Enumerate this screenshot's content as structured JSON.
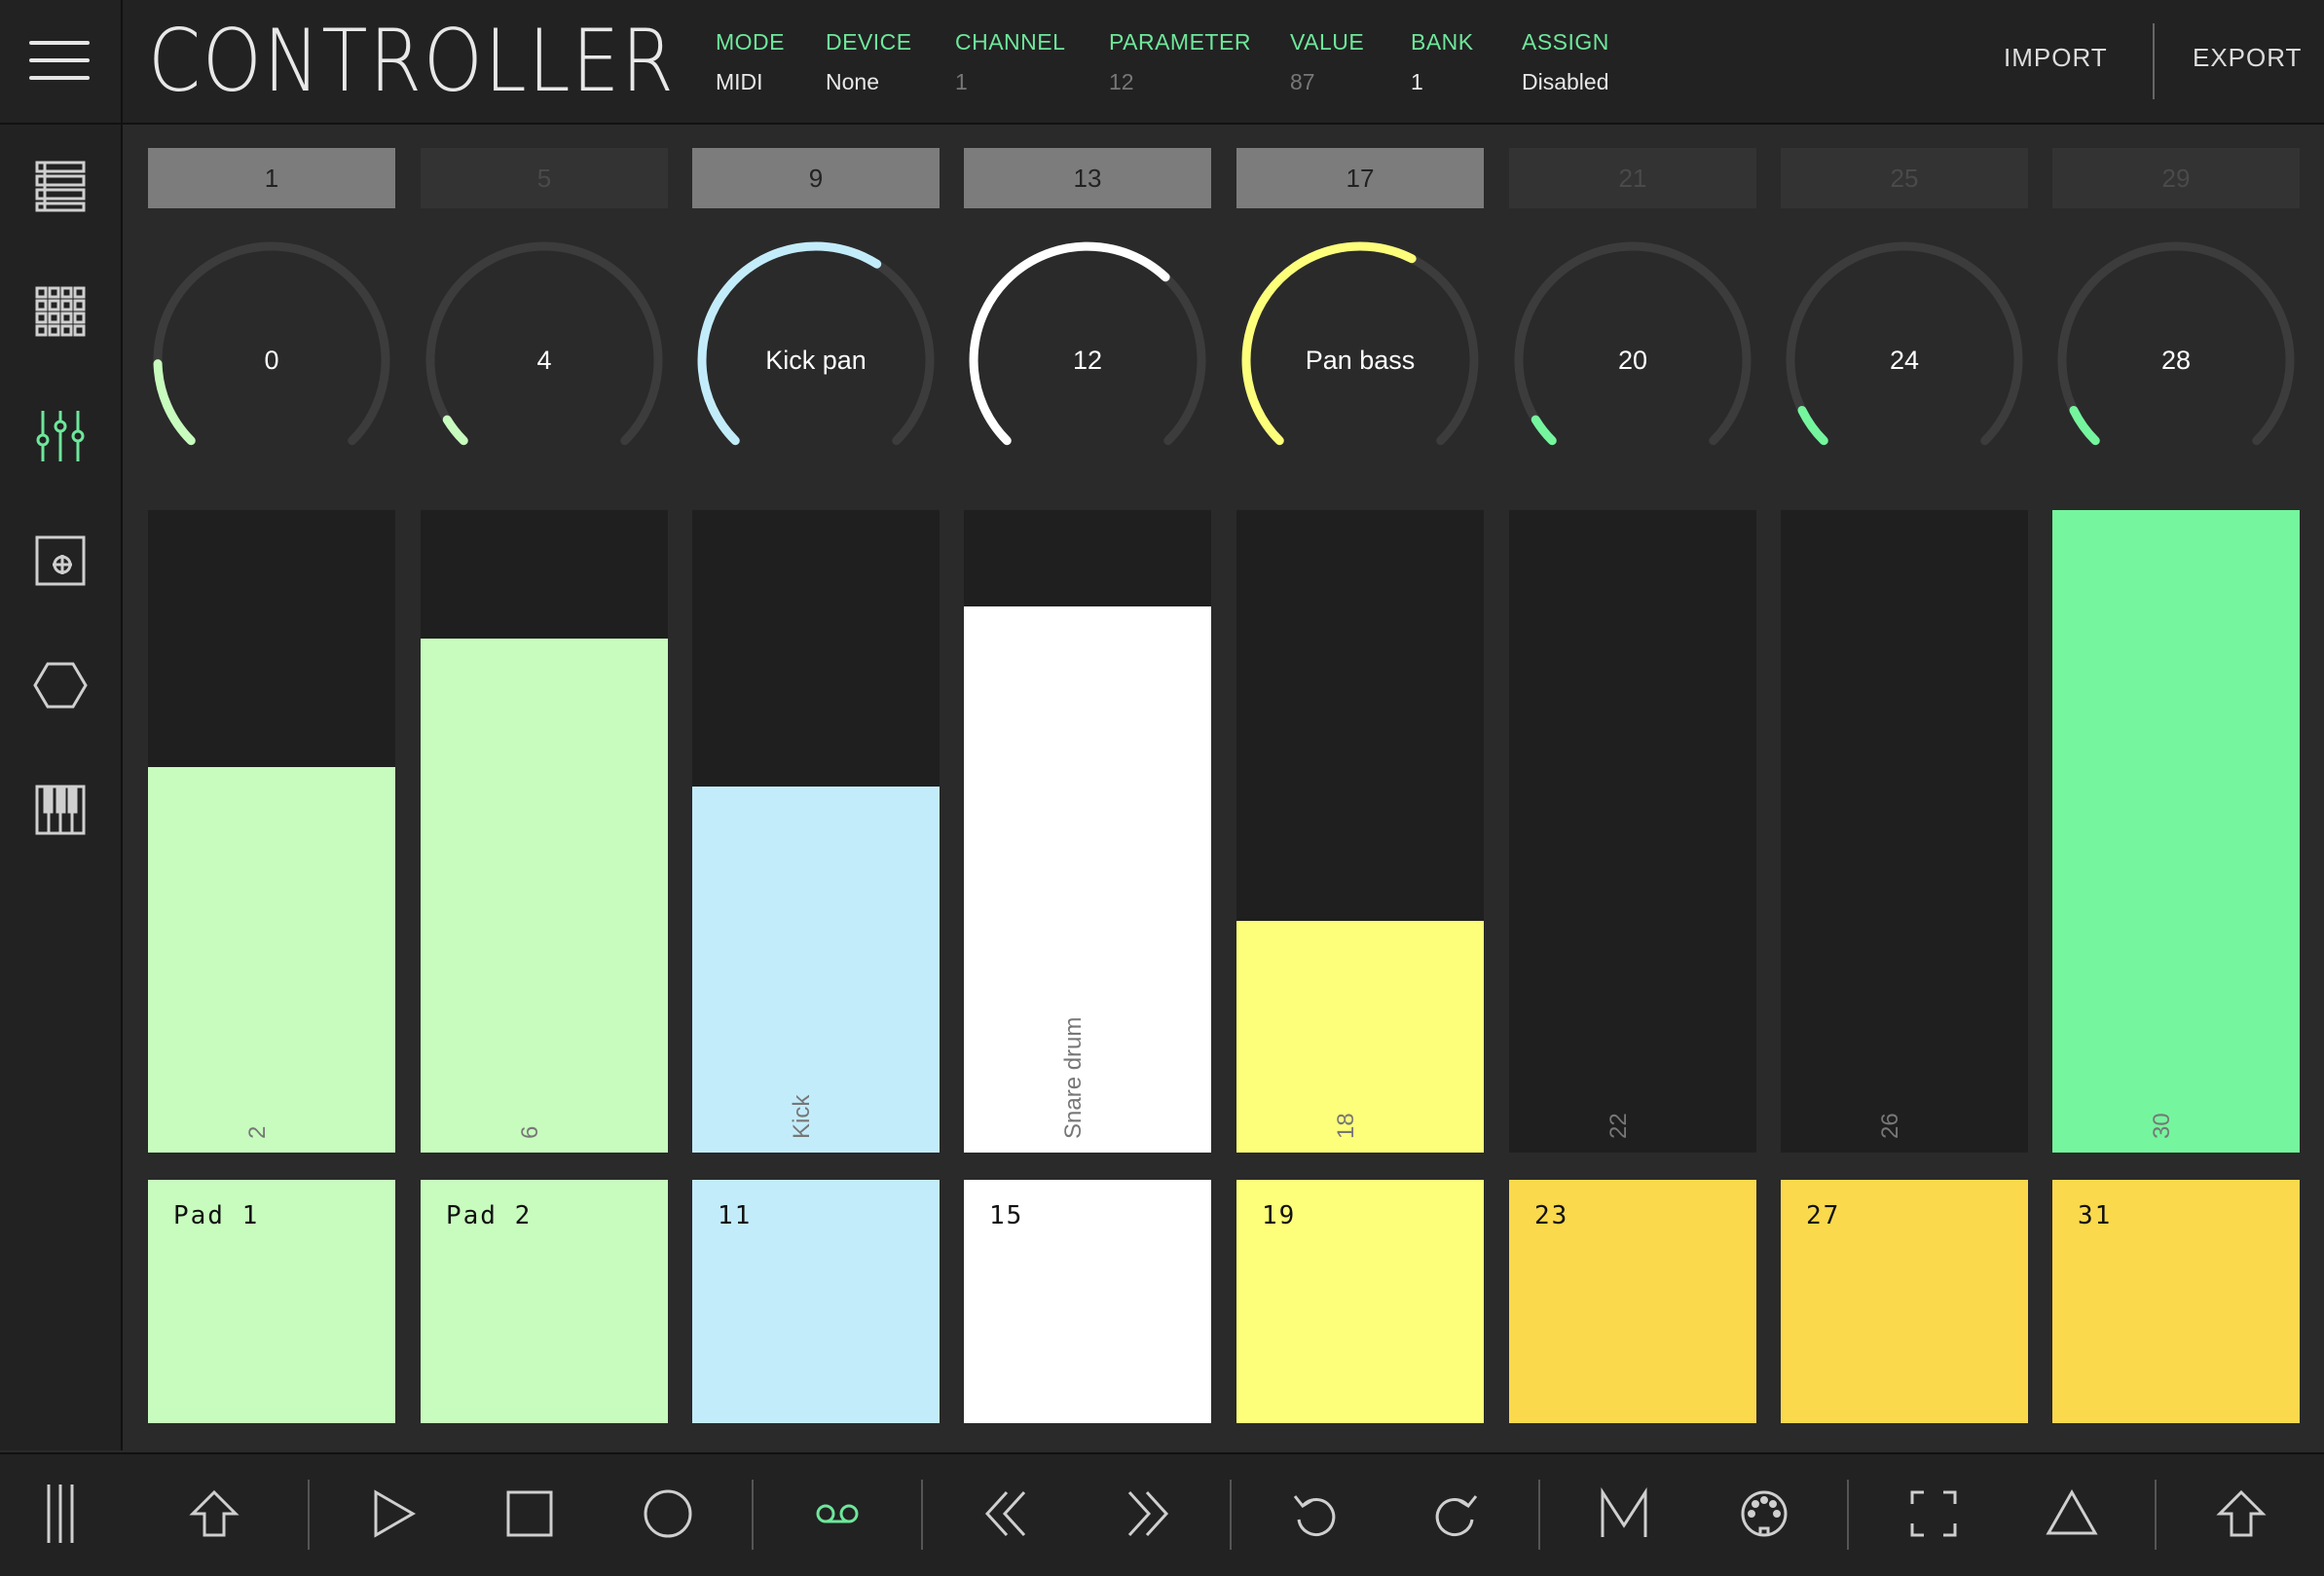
{
  "app": {
    "title": "CONTROLLER"
  },
  "header": {
    "mode": {
      "label": "MODE",
      "value": "MIDI"
    },
    "device": {
      "label": "DEVICE",
      "value": "None"
    },
    "channel": {
      "label": "CHANNEL",
      "value": "1"
    },
    "parameter": {
      "label": "PARAMETER",
      "value": "12"
    },
    "value": {
      "label": "VALUE",
      "value": "87"
    },
    "bank": {
      "label": "BANK",
      "value": "1"
    },
    "assign": {
      "label": "ASSIGN",
      "value": "Disabled"
    },
    "import_label": "IMPORT",
    "export_label": "EXPORT"
  },
  "sidebar": {
    "items": [
      {
        "icon": "list-icon"
      },
      {
        "icon": "grid-icon"
      },
      {
        "icon": "mixer-sliders-icon",
        "active": true
      },
      {
        "icon": "xy-pad-icon"
      },
      {
        "icon": "hexagon-icon"
      },
      {
        "icon": "piano-keys-icon"
      }
    ]
  },
  "colors": {
    "accent": "#6ee79b",
    "light_green": "#c8fcbe",
    "light_blue": "#c3ecfb",
    "white": "#ffffff",
    "yellow": "#fdfe7a",
    "orange_yellow": "#fad94d",
    "green": "#75f59e",
    "knob_track": "#3c3c3c"
  },
  "channels": [
    {
      "bank_label": "1",
      "bank_active": true,
      "knob_label": "0",
      "knob_level": 0.16,
      "knob_color": "#c8fcbe",
      "fader_label": "2",
      "fader_level": 0.6,
      "fader_color": "#c8fcbe",
      "pad_label": "Pad 1",
      "pad_color": "#c8fcbe"
    },
    {
      "bank_label": "5",
      "bank_active": false,
      "knob_label": "4",
      "knob_level": 0.05,
      "knob_color": "#c8fcbe",
      "fader_label": "6",
      "fader_level": 0.8,
      "fader_color": "#c8fcbe",
      "pad_label": "Pad 2",
      "pad_color": "#c8fcbe"
    },
    {
      "bank_label": "9",
      "bank_active": true,
      "knob_label": "Kick pan",
      "knob_level": 0.62,
      "knob_color": "#c3ecfb",
      "fader_label": "Kick",
      "fader_level": 0.57,
      "fader_color": "#c3ecfb",
      "pad_label": "11",
      "pad_color": "#c3ecfb"
    },
    {
      "bank_label": "13",
      "bank_active": true,
      "knob_label": "12",
      "knob_level": 0.66,
      "knob_color": "#ffffff",
      "fader_label": "Snare drum",
      "fader_level": 0.85,
      "fader_color": "#ffffff",
      "pad_label": "15",
      "pad_color": "#ffffff"
    },
    {
      "bank_label": "17",
      "bank_active": true,
      "knob_label": "Pan bass",
      "knob_level": 0.6,
      "knob_color": "#fdfe7a",
      "fader_label": "18",
      "fader_level": 0.36,
      "fader_color": "#fdfe7a",
      "pad_label": "19",
      "pad_color": "#fdfe7a"
    },
    {
      "bank_label": "21",
      "bank_active": false,
      "knob_label": "20",
      "knob_level": 0.05,
      "knob_color": "#75f59e",
      "fader_label": "22",
      "fader_level": 0,
      "fader_color": "#75f59e",
      "pad_label": "23",
      "pad_color": "#fad94d"
    },
    {
      "bank_label": "25",
      "bank_active": false,
      "knob_label": "24",
      "knob_level": 0.07,
      "knob_color": "#75f59e",
      "fader_label": "26",
      "fader_level": 0,
      "fader_color": "#75f59e",
      "pad_label": "27",
      "pad_color": "#fad94d"
    },
    {
      "bank_label": "29",
      "bank_active": false,
      "knob_label": "28",
      "knob_level": 0.07,
      "knob_color": "#75f59e",
      "fader_label": "30",
      "fader_level": 1.0,
      "fader_color": "#75f59e",
      "pad_label": "31",
      "pad_color": "#fad94d"
    }
  ],
  "bottombar": {
    "icons": [
      "side-panel-icon",
      "shift-up-icon",
      "play-icon",
      "stop-icon",
      "record-icon",
      "loop-tape-icon",
      "rewind-icon",
      "fast-forward-icon",
      "undo-icon",
      "redo-icon",
      "metronome-m-icon",
      "midi-port-icon",
      "fullscreen-icon",
      "triangle-icon",
      "shift-up-icon-right"
    ]
  }
}
